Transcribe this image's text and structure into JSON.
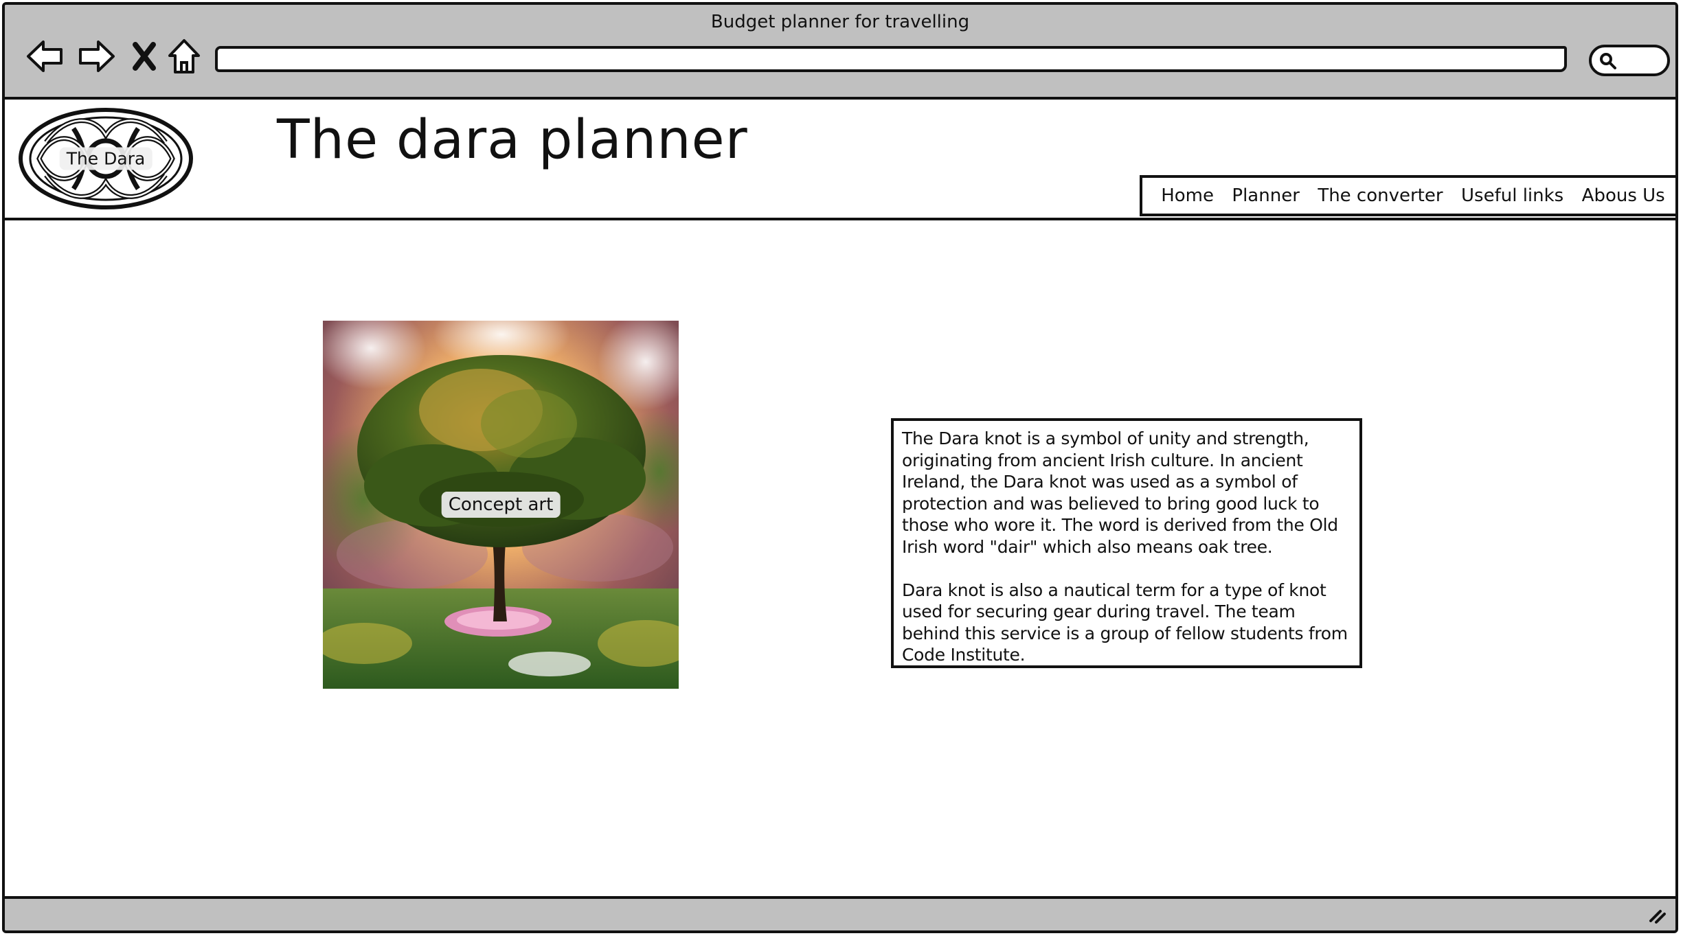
{
  "window": {
    "title": "Budget planner for travelling"
  },
  "toolbar": {
    "icons": [
      "back-arrow-icon",
      "forward-arrow-icon",
      "close-x-icon",
      "home-icon",
      "search-icon"
    ],
    "address_value": ""
  },
  "header": {
    "logo_label": "The Dara",
    "title": "The dara planner",
    "nav": [
      {
        "label": "Home"
      },
      {
        "label": "Planner"
      },
      {
        "label": "The converter"
      },
      {
        "label": "Useful links"
      },
      {
        "label": "Abous Us"
      }
    ]
  },
  "main": {
    "image_label": "Concept art",
    "paragraphs": [
      "The Dara knot is a symbol of unity and strength, originating from ancient Irish culture.  In ancient Ireland, the Dara knot was used as a symbol of protection and was believed to bring good luck to those who wore it. The word is derived from the Old Irish word \"dair\" which also means oak tree.",
      "Dara knot is also a nautical term for a type of knot used for securing gear during travel. The team behind this service is a group of fellow students from Code Institute."
    ]
  },
  "colors": {
    "chrome": "#c0c0c0",
    "border": "#111111",
    "background": "#ffffff"
  }
}
